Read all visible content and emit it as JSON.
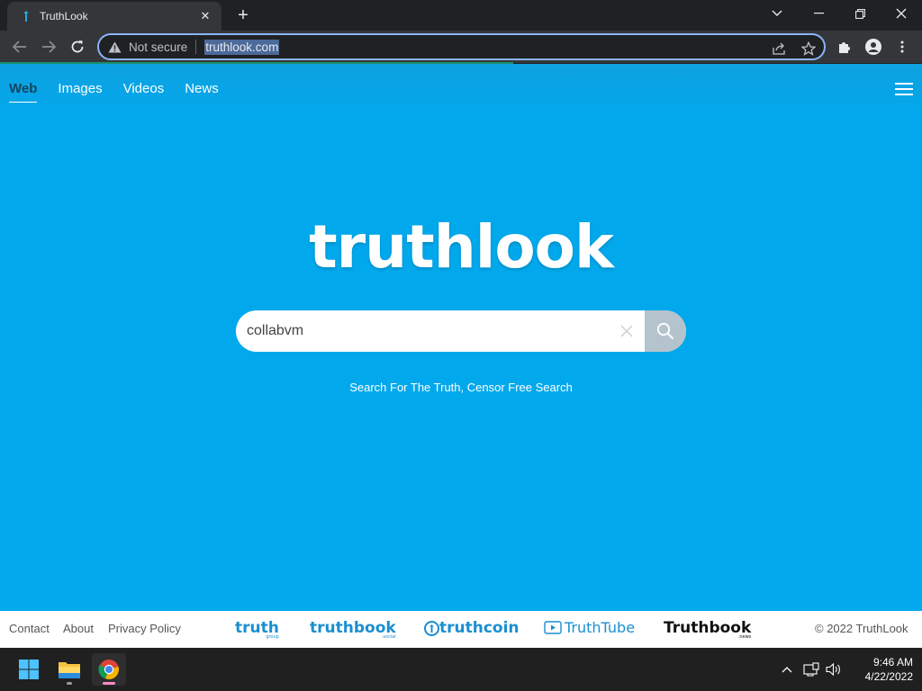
{
  "browser": {
    "tab_title": "TruthLook",
    "tab_close": "✕",
    "new_tab": "+",
    "security_label": "Not secure",
    "url": "truthlook.com"
  },
  "page": {
    "nav": [
      "Web",
      "Images",
      "Videos",
      "News"
    ],
    "logo": "truthlook",
    "search": {
      "value": "collabvm"
    },
    "tagline": "Search For The Truth, Censor Free Search"
  },
  "footer": {
    "links": [
      "Contact",
      "About",
      "Privacy Policy"
    ],
    "brands": [
      {
        "name": "truth",
        "sub": "group",
        "color": "#1a8fd0"
      },
      {
        "name": "truthbook",
        "sub": ".social",
        "color": "#1a8fd0"
      },
      {
        "name": "truthcoin",
        "sub": "",
        "color": "#1a8fd0"
      },
      {
        "name": "TruthTube",
        "sub": "",
        "color": "#1a8fd0"
      },
      {
        "name": "Truthbook",
        "sub": ".news",
        "color": "#111111"
      }
    ],
    "copyright": "© 2022 TruthLook"
  },
  "taskbar": {
    "time": "9:46 AM",
    "date": "4/22/2022"
  },
  "colors": {
    "page_bg": "#02a9ed",
    "accent": "#8ab4f8",
    "brand_blue": "#1a8fd0"
  }
}
